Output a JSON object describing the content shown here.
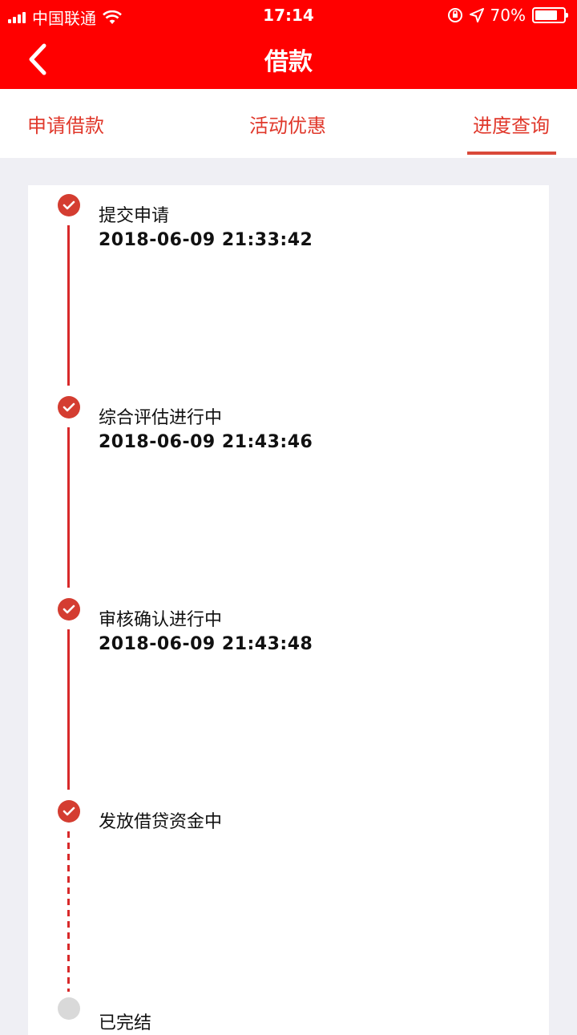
{
  "status_bar": {
    "carrier": "中国联通",
    "time": "17:14",
    "battery": "70%",
    "battery_level": 0.7
  },
  "nav": {
    "title": "借款",
    "back_icon": "chevron-left-icon"
  },
  "tabs": [
    {
      "label": "申请借款",
      "active": false
    },
    {
      "label": "活动优惠",
      "active": false
    },
    {
      "label": "进度查询",
      "active": true
    }
  ],
  "colors": {
    "header_red": "#ff0000",
    "accent": "#d43d31",
    "pending_grey": "#d9d9d9"
  },
  "steps": [
    {
      "title": "提交申请",
      "time": "2018-06-09 21:33:42",
      "done": true
    },
    {
      "title": "综合评估进行中",
      "time": "2018-06-09 21:43:46",
      "done": true
    },
    {
      "title": "审核确认进行中",
      "time": "2018-06-09 21:43:48",
      "done": true
    },
    {
      "title": "发放借贷资金中",
      "time": "",
      "done": true
    },
    {
      "title": "已完结",
      "time": "",
      "done": false
    }
  ]
}
